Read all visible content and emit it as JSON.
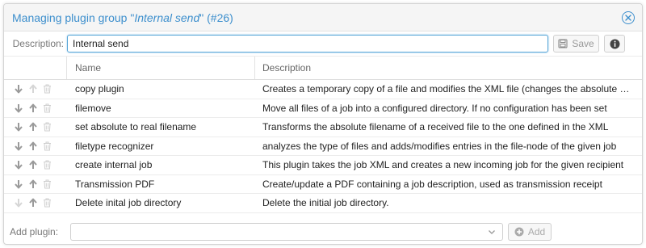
{
  "dialog": {
    "title_prefix": "Managing plugin group \"",
    "title_name": "Internal send",
    "title_suffix": "\" (",
    "title_num": "#26",
    "title_end": ")"
  },
  "description_row": {
    "label": "Description:",
    "value": "Internal send",
    "save_label": "Save"
  },
  "table": {
    "headers": {
      "name": "Name",
      "description": "Description"
    },
    "rows": [
      {
        "name": "copy plugin",
        "description": "Creates a temporary copy of a file and modifies the XML file (changes the absolute filename)",
        "down_enabled": true,
        "up_enabled": false
      },
      {
        "name": "filemove",
        "description": "Move all files of a job into a configured directory. If no configuration has been set",
        "down_enabled": true,
        "up_enabled": true
      },
      {
        "name": "set absolute to real filename",
        "description": "Transforms the absolute filename of a received file to the one defined in the XML",
        "down_enabled": true,
        "up_enabled": true
      },
      {
        "name": "filetype recognizer",
        "description": "analyzes the type of files and adds/modifies entries in the file-node of the given job",
        "down_enabled": true,
        "up_enabled": true
      },
      {
        "name": "create internal job",
        "description": "This plugin takes the job XML and creates a new incoming job for the given recipient",
        "down_enabled": true,
        "up_enabled": true
      },
      {
        "name": "Transmission PDF",
        "description": "Create/update a PDF containing a job description, used as transmission receipt",
        "down_enabled": true,
        "up_enabled": true
      },
      {
        "name": "Delete inital job directory",
        "description": "Delete the initial job directory.",
        "down_enabled": false,
        "up_enabled": true
      }
    ]
  },
  "add_row": {
    "label": "Add plugin:",
    "selected": "",
    "add_label": "Add"
  },
  "colors": {
    "accent": "#3d8fcd",
    "icon_enabled": "#9a9a9a",
    "icon_disabled": "#d6d6d6"
  },
  "icons": [
    "close-icon",
    "save-icon",
    "info-icon",
    "arrow-down-icon",
    "arrow-up-icon",
    "trash-icon",
    "chevron-down-icon",
    "plus-circle-icon"
  ]
}
